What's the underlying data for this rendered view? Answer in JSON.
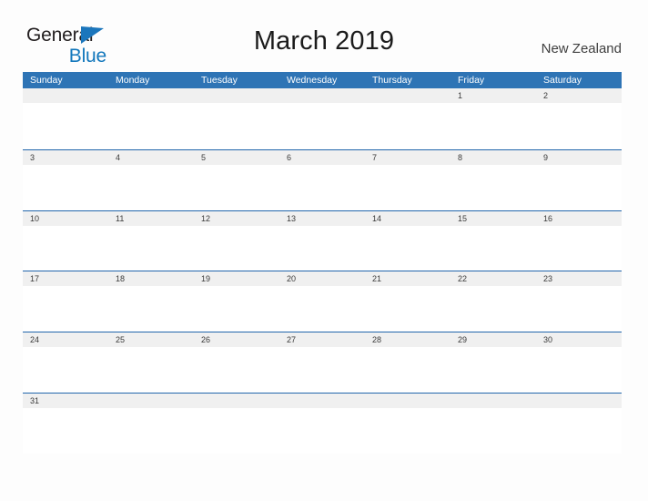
{
  "brand": {
    "word1": "General",
    "word2": "Blue",
    "flag_icon": "blue-triangle-flag-icon",
    "word1_color": "#231f20",
    "word2_color": "#1277bc"
  },
  "header": {
    "title": "March 2019",
    "region": "New Zealand"
  },
  "colors": {
    "header_blue": "#2e74b5",
    "row_rule_blue": "#2166ac",
    "date_strip_gray": "#f0f0f0",
    "date_text": "#3a3a3a",
    "page_background": "#fdfdfd"
  },
  "calendar": {
    "month": "March",
    "year": "2019",
    "weekdays": [
      "Sunday",
      "Monday",
      "Tuesday",
      "Wednesday",
      "Thursday",
      "Friday",
      "Saturday"
    ],
    "weeks": [
      [
        "",
        "",
        "",
        "",
        "",
        "1",
        "2"
      ],
      [
        "3",
        "4",
        "5",
        "6",
        "7",
        "8",
        "9"
      ],
      [
        "10",
        "11",
        "12",
        "13",
        "14",
        "15",
        "16"
      ],
      [
        "17",
        "18",
        "19",
        "20",
        "21",
        "22",
        "23"
      ],
      [
        "24",
        "25",
        "26",
        "27",
        "28",
        "29",
        "30"
      ],
      [
        "31",
        "",
        "",
        "",
        "",
        "",
        ""
      ]
    ]
  }
}
